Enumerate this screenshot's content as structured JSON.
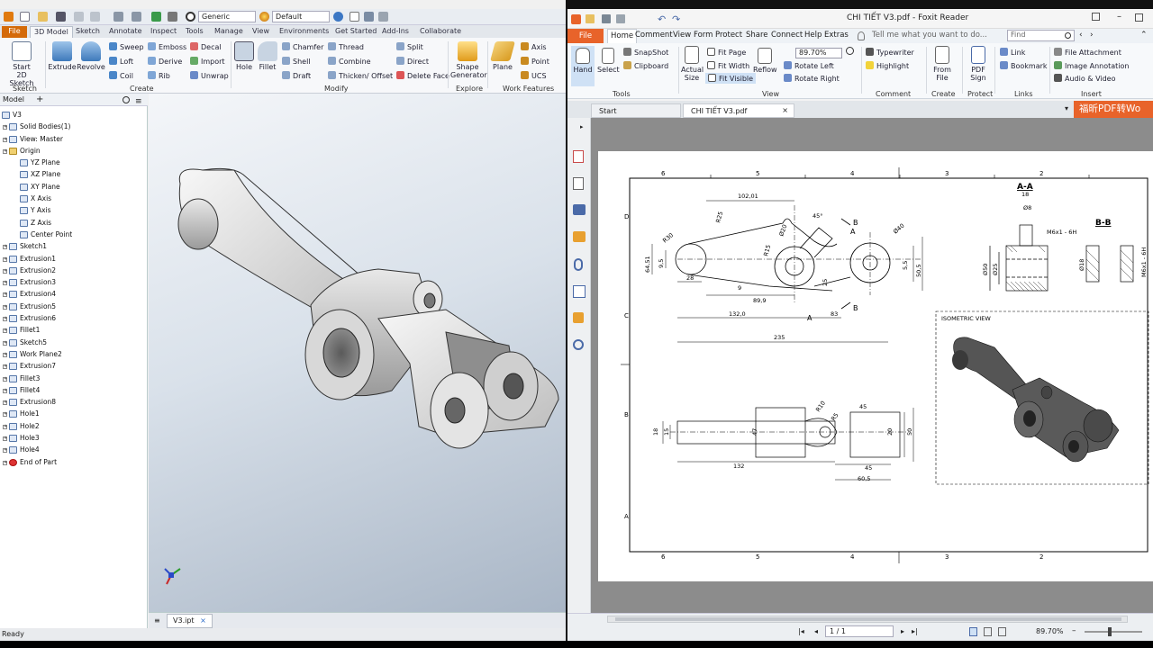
{
  "inventor": {
    "quick_access": {
      "appearance": "Generic",
      "visual_style": "Default"
    },
    "tabs": [
      "File",
      "3D Model",
      "Sketch",
      "Annotate",
      "Inspect",
      "Tools",
      "Manage",
      "View",
      "Environments",
      "Get Started",
      "Add-Ins",
      "Collaborate"
    ],
    "ribbon": {
      "start_sketch": "Start\n2D Sketch",
      "extrude": "Extrude",
      "revolve": "Revolve",
      "sweep": "Sweep",
      "loft": "Loft",
      "coil": "Coil",
      "emboss": "Emboss",
      "derive": "Derive",
      "rib": "Rib",
      "decal": "Decal",
      "import": "Import",
      "unwrap": "Unwrap",
      "hole": "Hole",
      "fillet": "Fillet",
      "chamfer": "Chamfer",
      "shell": "Shell",
      "draft": "Draft",
      "thread": "Thread",
      "combine": "Combine",
      "thicken": "Thicken/ Offset",
      "split": "Split",
      "direct": "Direct",
      "delete_face": "Delete Face",
      "shape_generator": "Shape\nGenerator",
      "plane": "Plane",
      "axis": "Axis",
      "point": "Point",
      "ucs": "UCS",
      "groups": {
        "sketch": "Sketch",
        "create": "Create",
        "modify": "Modify",
        "explore": "Explore",
        "work_features": "Work Features"
      }
    },
    "browser": {
      "header": "Model",
      "items": [
        {
          "label": "V3",
          "lvl": 0
        },
        {
          "label": "Solid Bodies(1)",
          "lvl": 1
        },
        {
          "label": "View: Master",
          "lvl": 1
        },
        {
          "label": "Origin",
          "lvl": 1
        },
        {
          "label": "YZ Plane",
          "lvl": 2
        },
        {
          "label": "XZ Plane",
          "lvl": 2
        },
        {
          "label": "XY Plane",
          "lvl": 2
        },
        {
          "label": "X Axis",
          "lvl": 2
        },
        {
          "label": "Y Axis",
          "lvl": 2
        },
        {
          "label": "Z Axis",
          "lvl": 2
        },
        {
          "label": "Center Point",
          "lvl": 2
        },
        {
          "label": "Sketch1",
          "lvl": 1
        },
        {
          "label": "Extrusion1",
          "lvl": 1
        },
        {
          "label": "Extrusion2",
          "lvl": 1
        },
        {
          "label": "Extrusion3",
          "lvl": 1
        },
        {
          "label": "Extrusion4",
          "lvl": 1
        },
        {
          "label": "Extrusion5",
          "lvl": 1
        },
        {
          "label": "Extrusion6",
          "lvl": 1
        },
        {
          "label": "Fillet1",
          "lvl": 1
        },
        {
          "label": "Sketch5",
          "lvl": 1
        },
        {
          "label": "Work Plane2",
          "lvl": 1
        },
        {
          "label": "Extrusion7",
          "lvl": 1
        },
        {
          "label": "Fillet3",
          "lvl": 1
        },
        {
          "label": "Fillet4",
          "lvl": 1
        },
        {
          "label": "Extrusion8",
          "lvl": 1
        },
        {
          "label": "Hole1",
          "lvl": 1
        },
        {
          "label": "Hole2",
          "lvl": 1
        },
        {
          "label": "Hole3",
          "lvl": 1
        },
        {
          "label": "Hole4",
          "lvl": 1
        },
        {
          "label": "End of Part",
          "lvl": 1
        }
      ]
    },
    "doc_tab": "V3.ipt",
    "status": "Ready"
  },
  "foxit": {
    "title": "CHI TIẾT V3.pdf - Foxit Reader",
    "menu": [
      "File",
      "Home",
      "Comment",
      "View",
      "Form",
      "Protect",
      "Share",
      "Connect",
      "Help",
      "Extras"
    ],
    "tell_me": "Tell me what you want to do...",
    "find_placeholder": "Find",
    "ribbon": {
      "hand": "Hand",
      "select": "Select",
      "snapshot": "SnapShot",
      "clipboard": "Clipboard",
      "actual_size": "Actual\nSize",
      "fit_page": "Fit Page",
      "fit_width": "Fit Width",
      "fit_visible": "Fit Visible",
      "reflow": "Reflow",
      "zoom": "89.70%",
      "rotate_left": "Rotate Left",
      "rotate_right": "Rotate Right",
      "typewriter": "Typewriter",
      "highlight": "Highlight",
      "from_file": "From\nFile",
      "pdf_sign": "PDF\nSign",
      "link": "Link",
      "bookmark": "Bookmark",
      "file_attachment": "File Attachment",
      "image_annotation": "Image Annotation",
      "audio_video": "Audio & Video",
      "groups": {
        "tools": "Tools",
        "view": "View",
        "comment": "Comment",
        "create": "Create",
        "protect": "Protect",
        "links": "Links",
        "insert": "Insert"
      }
    },
    "tabs": [
      "Start",
      "CHI TIẾT V3.pdf"
    ],
    "banner": "福昕PDF转Wo",
    "page_indicator": "1 / 1",
    "zoom_status": "89.70%",
    "drawing": {
      "col_labels": [
        "6",
        "5",
        "4",
        "3",
        "2"
      ],
      "row_labels": [
        "D",
        "C",
        "B",
        "A"
      ],
      "dims": [
        "102,01",
        "R25",
        "R30",
        "Ø20",
        "45°",
        "Ø40",
        "R15",
        "9,5",
        "64,51",
        "28",
        "9",
        "89,9",
        "132,0",
        "83",
        "235",
        "25",
        "5,5",
        "50,5",
        "A",
        "B",
        "B",
        "A"
      ],
      "section_aa": "A-A",
      "section_bb": "B-B",
      "aa_dims": [
        "18",
        "Ø8",
        "M6x1 - 6H",
        "Ø50",
        "Ø25"
      ],
      "bb_dims": [
        "Ø18",
        "M6x1 - 6H"
      ],
      "bottom_dims": [
        "R10",
        "R5",
        "18",
        "15",
        "47",
        "20",
        "132",
        "45",
        "60,5",
        "45",
        "50"
      ],
      "isometric_label": "ISOMETRIC VIEW"
    }
  }
}
